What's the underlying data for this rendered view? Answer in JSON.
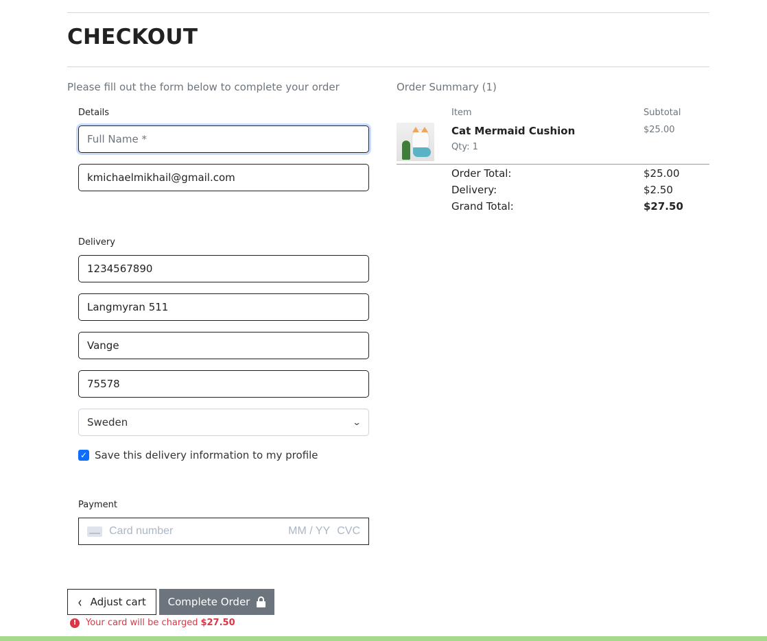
{
  "page": {
    "title": "CHECKOUT",
    "intro": "Please fill out the form below to complete your order"
  },
  "details": {
    "label": "Details",
    "full_name_placeholder": "Full Name *",
    "email_value": "kmichaelmikhail@gmail.com"
  },
  "delivery": {
    "label": "Delivery",
    "phone_value": "1234567890",
    "street_value": "Langmyran 511",
    "town_value": "Vange",
    "postcode_value": "75578",
    "country_value": "Sweden",
    "save_info_label": "Save this delivery information to my profile",
    "save_info_checked": true
  },
  "payment": {
    "label": "Payment",
    "card_placeholder": "Card number",
    "expiry_placeholder": "MM / YY",
    "cvc_placeholder": "CVC"
  },
  "actions": {
    "adjust_cart_label": "Adjust cart",
    "complete_order_label": "Complete Order",
    "charge_notice": "Your card will be charged",
    "charge_amount": "$27.50"
  },
  "summary": {
    "heading": "Order Summary (1)",
    "col_item": "Item",
    "col_subtotal": "Subtotal",
    "items": [
      {
        "name": "Cat Mermaid Cushion",
        "qty": "Qty: 1",
        "subtotal": "$25.00"
      }
    ],
    "order_total_label": "Order Total:",
    "order_total_value": "$25.00",
    "delivery_label": "Delivery:",
    "delivery_value": "$2.50",
    "grand_total_label": "Grand Total:",
    "grand_total_value": "$27.50"
  },
  "colors": {
    "accent": "#0d6efd",
    "button_secondary": "#6c757d",
    "danger": "#dc3545",
    "footer_bar": "#a6d98c"
  }
}
